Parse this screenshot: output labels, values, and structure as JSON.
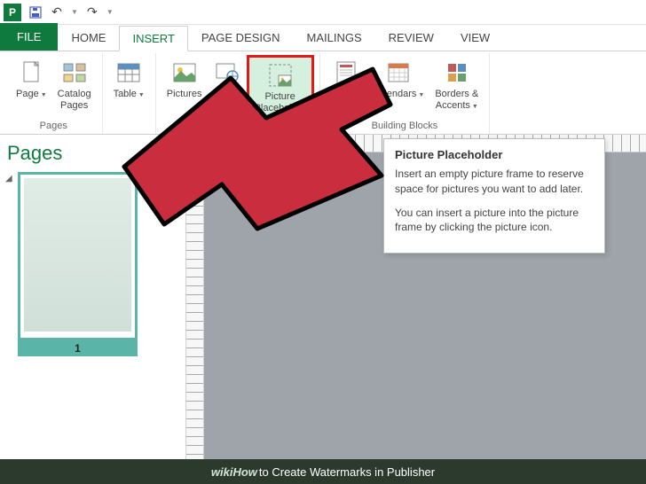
{
  "titlebar": {
    "app_letter": "P"
  },
  "tabs": {
    "file": "FILE",
    "home": "HOME",
    "insert": "INSERT",
    "page_design": "PAGE DESIGN",
    "mailings": "MAILINGS",
    "review": "REVIEW",
    "view": "VIEW"
  },
  "ribbon": {
    "groups": {
      "pages": "Pages",
      "building_blocks": "Building Blocks"
    },
    "buttons": {
      "page": "Page",
      "catalog_pages": "Catalog\nPages",
      "table": "Table",
      "pictures": "Pictures",
      "online": "Online",
      "picture_placeholder": "Picture\nPlaceholder",
      "page_parts": "Page\nParts",
      "calendars": "Calendars",
      "borders_accents": "Borders &\nAccents"
    }
  },
  "pages_panel": {
    "title": "Pages",
    "page_number": "1"
  },
  "tooltip": {
    "title": "Picture Placeholder",
    "para1": "Insert an empty picture frame to reserve space for pictures you want to add later.",
    "para2": "You can insert a picture into the picture frame by clicking the picture icon."
  },
  "footer": {
    "brand": "wikiHow",
    "text": " to Create Watermarks in Publisher"
  }
}
